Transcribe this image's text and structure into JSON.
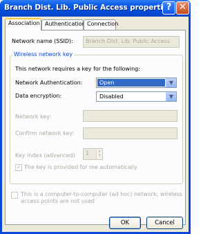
{
  "window": {
    "title": "Branch Dist. Lib. Public Access properties"
  },
  "titlebar": {
    "help": "?",
    "close": "✕"
  },
  "tabs": [
    {
      "label": "Association",
      "active": true
    },
    {
      "label": "Authentication",
      "active": false
    },
    {
      "label": "Connection",
      "active": false
    }
  ],
  "association": {
    "ssid_label": "Network name (SSID):",
    "ssid_value": "Branch Dist. Lib. Public Access",
    "group_title": "Wireless network key",
    "requires_text": "This network requires a key for the following:",
    "auth_label": "Network Authentication:",
    "auth_value": "Open",
    "enc_label": "Data encryption:",
    "enc_value": "Disabled",
    "netkey_label": "Network key:",
    "confirm_label": "Confirm network key:",
    "keyindex_label": "Key index (advanced)",
    "keyindex_value": "1",
    "auto_key_label": "The key is provided for me automatically",
    "adhoc_line1": "This is a computer-to-computer (ad hoc) network; wireless",
    "adhoc_line2": "access points are not used"
  },
  "buttons": {
    "ok": "OK",
    "cancel": "Cancel"
  }
}
